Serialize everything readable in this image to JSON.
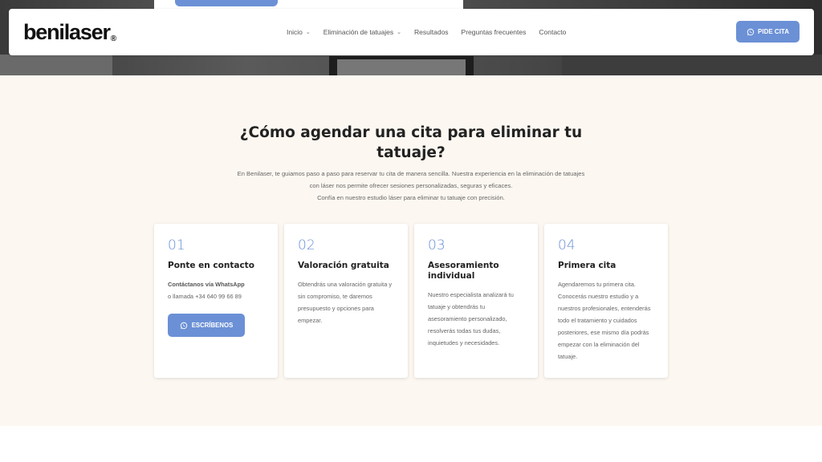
{
  "header": {
    "logo_text": "benilaser",
    "logo_mark": "®",
    "nav": [
      {
        "label": "Inicio",
        "has_dropdown": true
      },
      {
        "label": "Eliminación de tatuajes",
        "has_dropdown": true
      },
      {
        "label": "Resultados",
        "has_dropdown": false
      },
      {
        "label": "Preguntas frecuentes",
        "has_dropdown": false
      },
      {
        "label": "Contacto",
        "has_dropdown": false
      }
    ],
    "cta_label": "PIDE CITA",
    "cta_icon": "whatsapp-icon",
    "accent_color": "#6b90d6"
  },
  "section": {
    "title": "¿Cómo agendar una cita para eliminar tu tatuaje?",
    "intro_line1": "En Benilaser, te guiamos paso a paso para reservar tu cita de manera sencilla. Nuestra experiencia en la eliminación de tatuajes",
    "intro_line2": "con láser nos permite ofrecer sesiones personalizadas, seguras y eficaces.",
    "intro_line3": "Confía en nuestro estudio láser para eliminar tu tatuaje con precisión.",
    "background_color": "#fcf7f1"
  },
  "cards": [
    {
      "number": "01",
      "title": "Ponte en contacto",
      "text_bold": "Contáctanos vía WhatsApp",
      "text": "o llamada +34 640 99 66 89",
      "button_label": "ESCRÍBENOS",
      "button_icon": "whatsapp-icon"
    },
    {
      "number": "02",
      "title": "Valoración gratuita",
      "text": "Obtendrás una valoración gratuita y sin compromiso, te daremos presupuesto y opciones para empezar."
    },
    {
      "number": "03",
      "title": "Asesoramiento individual",
      "text": "Nuestro especialista analizará tu tatuaje y obtendrás tu asesoramiento personalizado, resolverás todas tus dudas, inquietudes y necesidades."
    },
    {
      "number": "04",
      "title": "Primera cita",
      "text": "Agendaremos tu primera cita. Conocerás nuestro estudio y a nuestros profesionales, entenderás todo el tratamiento y cuidados posteriores, ese mismo día podrás empezar con la eliminación del tatuaje."
    }
  ]
}
